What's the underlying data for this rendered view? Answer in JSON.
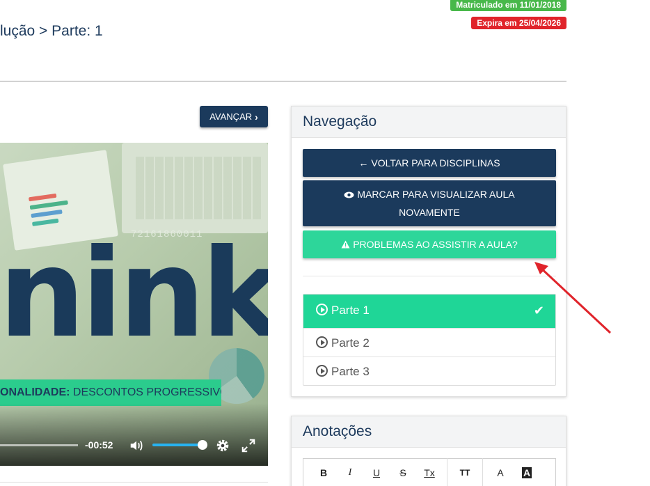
{
  "badges": {
    "enrolled": "Matriculado em 11/01/2018",
    "expires": "Expira em 25/04/2026"
  },
  "breadcrumb": "lução > Parte: 1",
  "advance_button": "AVANÇAR",
  "video": {
    "logo_text": "ninkr",
    "promo_prefix": "ONALIDADE:",
    "promo_text": "DESCONTOS PROGRESSIVOS",
    "overlay_number": "72161860011",
    "time_remaining": "-00:52",
    "volume_level": 0.9
  },
  "navigation": {
    "title": "Navegação",
    "back_button": "VOLTAR PARA DISCIPLINAS",
    "mark_button_line1": "MARCAR PARA VISUALIZAR AULA",
    "mark_button_line2": "NOVAMENTE",
    "problems_button": "PROBLEMAS AO ASSISTIR A AULA?",
    "parts": [
      {
        "label": "Parte 1",
        "active": true
      },
      {
        "label": "Parte 2",
        "active": false
      },
      {
        "label": "Parte 3",
        "active": false
      }
    ]
  },
  "notes": {
    "title": "Anotações",
    "toolbar": [
      "B",
      "I",
      "U",
      "S",
      "Tx",
      "TT",
      "A",
      "A"
    ]
  },
  "colors": {
    "primary": "#1b3a5c",
    "accent_green": "#1fd697",
    "enrolled_badge": "#48b84a",
    "expires_badge": "#e0242b",
    "annotation_arrow": "#e0242b"
  }
}
